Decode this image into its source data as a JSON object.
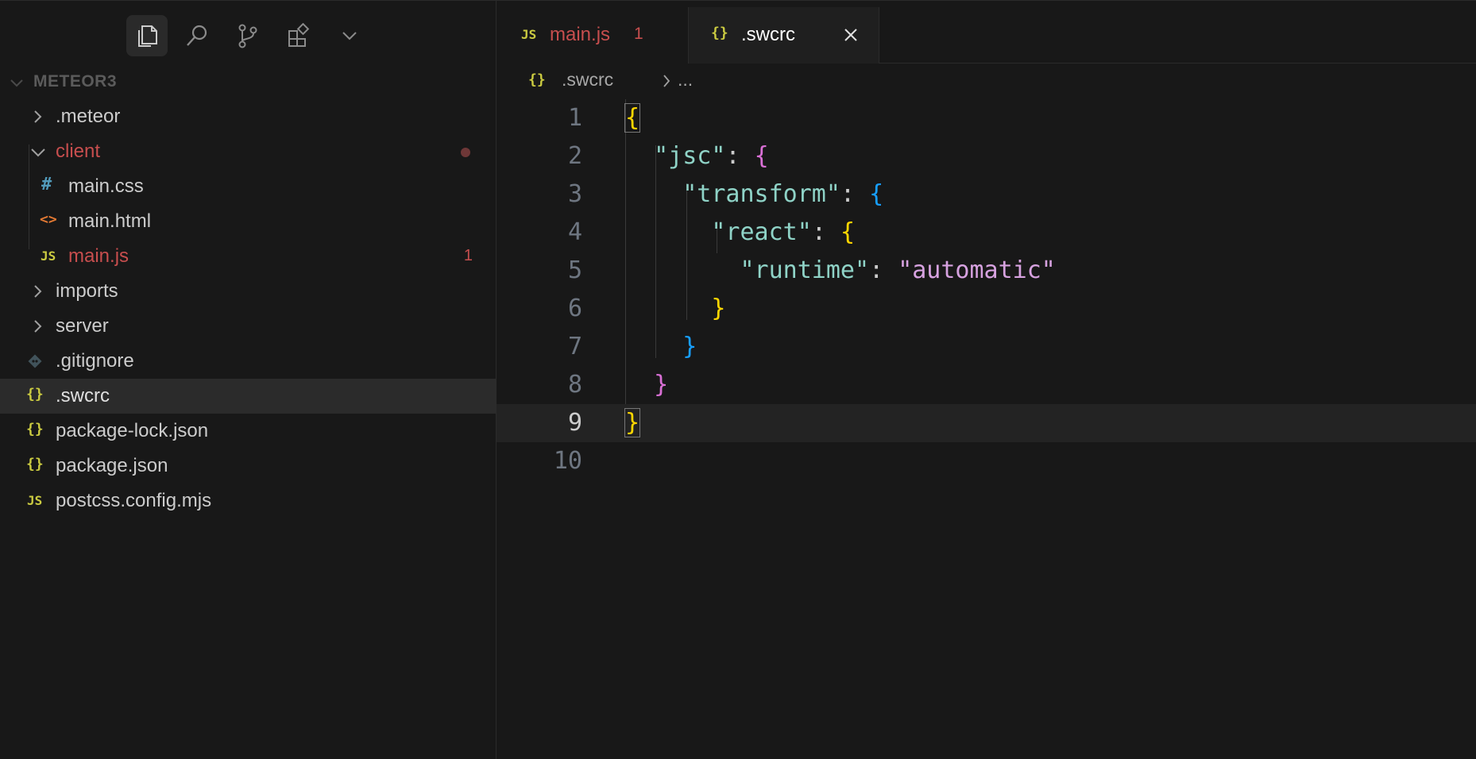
{
  "explorer": {
    "title": "METEOR3",
    "items": [
      {
        "label": ".meteor"
      },
      {
        "label": "client"
      },
      {
        "label": "main.css",
        "icon": "#"
      },
      {
        "label": "main.html",
        "icon": "<>"
      },
      {
        "label": "main.js",
        "icon": "JS",
        "badge": "1"
      },
      {
        "label": "imports"
      },
      {
        "label": "server"
      },
      {
        "label": ".gitignore"
      },
      {
        "label": ".swcrc",
        "icon": "{}"
      },
      {
        "label": "package-lock.json",
        "icon": "{}"
      },
      {
        "label": "package.json",
        "icon": "{}"
      },
      {
        "label": "postcss.config.mjs",
        "icon": "JS"
      }
    ]
  },
  "tabs": [
    {
      "icon": "JS",
      "label": "main.js",
      "badge": "1"
    },
    {
      "icon": "{}",
      "label": ".swcrc"
    }
  ],
  "breadcrumb": {
    "icon": "{}",
    "file": ".swcrc",
    "more": "..."
  },
  "editor": {
    "lines": [
      {
        "n": "1"
      },
      {
        "n": "2"
      },
      {
        "n": "3"
      },
      {
        "n": "4"
      },
      {
        "n": "5"
      },
      {
        "n": "6"
      },
      {
        "n": "7"
      },
      {
        "n": "8"
      },
      {
        "n": "9"
      },
      {
        "n": "10"
      }
    ],
    "current_line": "9",
    "tokens": {
      "jsc": "\"jsc\"",
      "transform": "\"transform\"",
      "react": "\"react\"",
      "runtime": "\"runtime\"",
      "automatic": "\"automatic\"",
      "colon": ": ",
      "open": "{",
      "close": "}"
    }
  },
  "colors": {
    "background": "#181818",
    "error": "#c74e4e",
    "json_icon": "#cbcb41",
    "js_icon": "#cbcb41",
    "css_icon": "#519aba",
    "html_icon": "#e37933"
  },
  "icons": {
    "explorer": "files-icon",
    "search": "search-icon",
    "source_control": "source-control-icon",
    "extensions": "extensions-icon",
    "more": "chevron-down-icon",
    "close_tab": "close-icon"
  }
}
